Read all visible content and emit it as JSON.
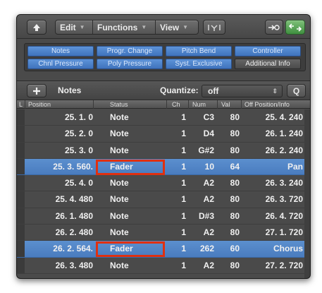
{
  "toolbar": {
    "edit_label": "Edit",
    "functions_label": "Functions",
    "view_label": "View"
  },
  "filters": {
    "row1": [
      "Notes",
      "Progr. Change",
      "Pitch Bend",
      "Controller"
    ],
    "row2": [
      "Chnl Pressure",
      "Poly Pressure",
      "Syst. Exclusive",
      "Additional Info"
    ]
  },
  "bar2": {
    "add_label": "+",
    "name": "Notes",
    "quantize_label": "Quantize:",
    "quantize_value": "off",
    "q_label": "Q"
  },
  "columns": {
    "l": "L",
    "position": "Position",
    "status": "Status",
    "ch": "Ch",
    "num": "Num",
    "val": "Val",
    "off": "Off Position/Info"
  },
  "rows": [
    {
      "pos": "25. 1.      0",
      "status": "Note",
      "ch": "1",
      "num": "C3",
      "val": "80",
      "off": "25. 4. 240",
      "selected": false
    },
    {
      "pos": "25. 2.      0",
      "status": "Note",
      "ch": "1",
      "num": "D4",
      "val": "80",
      "off": "26. 1. 240",
      "selected": false
    },
    {
      "pos": "25. 3.      0",
      "status": "Note",
      "ch": "1",
      "num": "G#2",
      "val": "80",
      "off": "26. 2. 240",
      "selected": false
    },
    {
      "pos": "25. 3. 560.",
      "status": "Fader",
      "ch": "1",
      "num": "10",
      "val": "64",
      "off": "Pan",
      "selected": true
    },
    {
      "pos": "25. 4.      0",
      "status": "Note",
      "ch": "1",
      "num": "A2",
      "val": "80",
      "off": "26. 3. 240",
      "selected": false
    },
    {
      "pos": "25. 4. 480",
      "status": "Note",
      "ch": "1",
      "num": "A2",
      "val": "80",
      "off": "26. 3. 720",
      "selected": false
    },
    {
      "pos": "26. 1. 480",
      "status": "Note",
      "ch": "1",
      "num": "D#3",
      "val": "80",
      "off": "26. 4. 720",
      "selected": false
    },
    {
      "pos": "26. 2. 480",
      "status": "Note",
      "ch": "1",
      "num": "A2",
      "val": "80",
      "off": "27. 1. 720",
      "selected": false
    },
    {
      "pos": "26. 2. 564.",
      "status": "Fader",
      "ch": "1",
      "num": "262",
      "val": "60",
      "off": "Chorus",
      "selected": true
    },
    {
      "pos": "26. 3. 480",
      "status": "Note",
      "ch": "1",
      "num": "A2",
      "val": "80",
      "off": "27. 2. 720",
      "selected": false
    }
  ],
  "colors": {
    "selection": "#4f83c4",
    "highlight_box": "#e03010",
    "filter_active": "#4a80c8"
  }
}
